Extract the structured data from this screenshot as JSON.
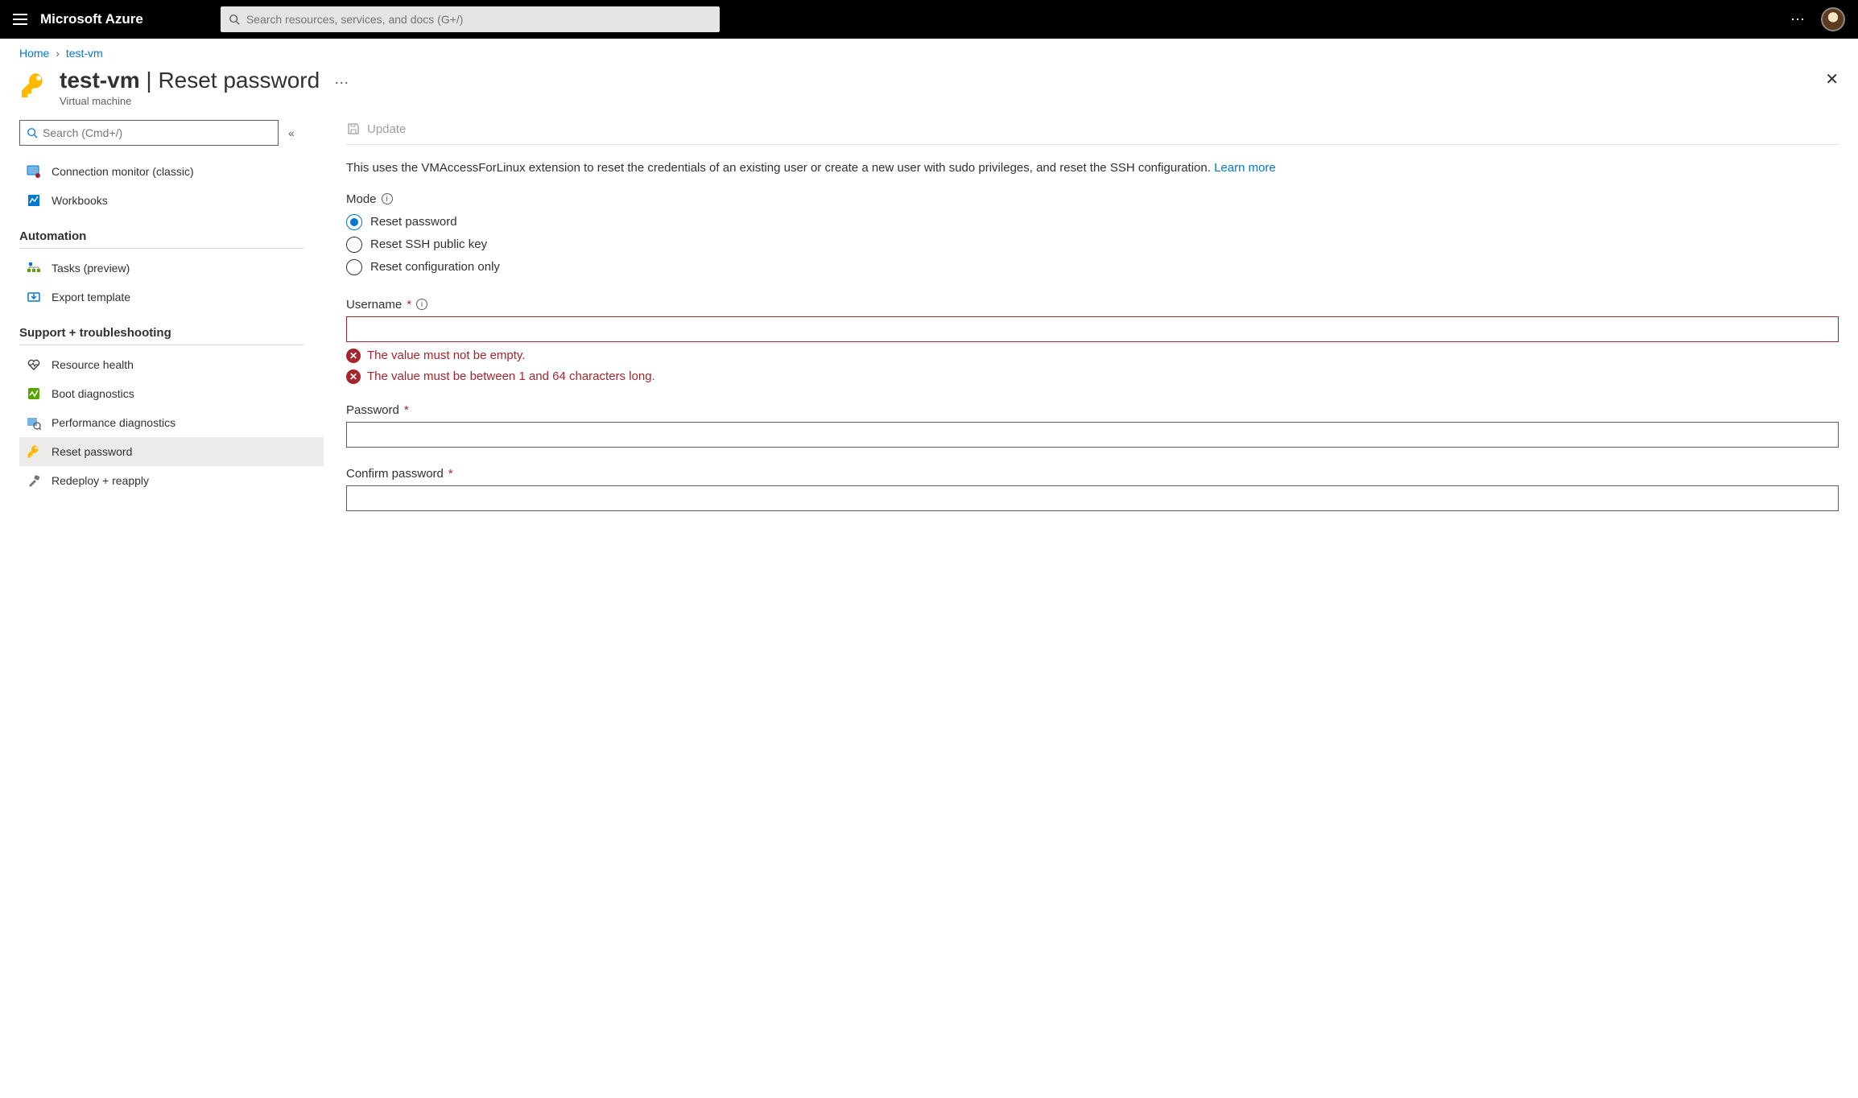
{
  "topbar": {
    "brand": "Microsoft Azure",
    "search_placeholder": "Search resources, services, and docs (G+/)"
  },
  "breadcrumb": {
    "home": "Home",
    "resource": "test-vm"
  },
  "header": {
    "resource_name": "test-vm",
    "page_name": "Reset password",
    "subtype": "Virtual machine"
  },
  "sidebar": {
    "search_placeholder": "Search (Cmd+/)",
    "items": [
      {
        "label": "Connection monitor (classic)"
      },
      {
        "label": "Workbooks"
      }
    ],
    "section_automation": "Automation",
    "automation_items": [
      {
        "label": "Tasks (preview)"
      },
      {
        "label": "Export template"
      }
    ],
    "section_support": "Support + troubleshooting",
    "support_items": [
      {
        "label": "Resource health"
      },
      {
        "label": "Boot diagnostics"
      },
      {
        "label": "Performance diagnostics"
      },
      {
        "label": "Reset password"
      },
      {
        "label": "Redeploy + reapply"
      }
    ]
  },
  "main": {
    "update_label": "Update",
    "description": "This uses the VMAccessForLinux extension to reset the credentials of an existing user or create a new user with sudo privileges, and reset the SSH configuration. ",
    "learn_more": "Learn more",
    "mode_label": "Mode",
    "mode_options": [
      "Reset password",
      "Reset SSH public key",
      "Reset configuration only"
    ],
    "username_label": "Username",
    "username_errors": [
      "The value must not be empty.",
      "The value must be between 1 and 64 characters long."
    ],
    "password_label": "Password",
    "confirm_label": "Confirm password"
  }
}
